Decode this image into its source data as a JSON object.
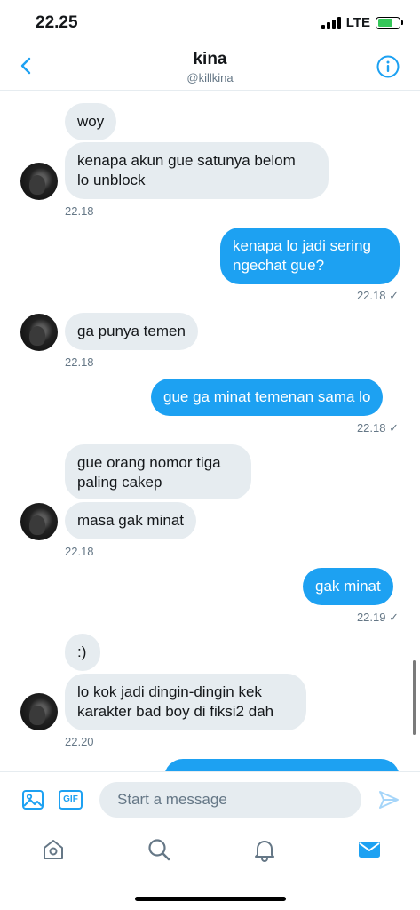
{
  "status": {
    "time": "22.25",
    "network": "LTE"
  },
  "header": {
    "name": "kina",
    "handle": "@killkina"
  },
  "messages": {
    "m1": "woy",
    "m2_l1": "kenapa akun gue satunya belom",
    "m2_l2": "lo unblock",
    "t1": "22.18",
    "m3_l1": "kenapa lo jadi sering",
    "m3_l2": "ngechat gue?",
    "t2": "22.18 ✓",
    "m4": "ga punya temen",
    "t3": "22.18",
    "m5": "gue ga minat temenan sama lo",
    "t4": "22.18 ✓",
    "m6_l1": "gue orang nomor tiga",
    "m6_l2": "paling cakep",
    "m7": "masa gak minat",
    "t5": "22.18",
    "m8": "gak minat",
    "t6": "22.19 ✓",
    "m9": ":)",
    "m10_l1": "lo kok jadi dingin-dingin kek",
    "m10_l2": "karakter bad boy di fiksi2 dah",
    "t7": "22.20"
  },
  "composer": {
    "gif_label": "GIF",
    "placeholder": "Start a message"
  },
  "colors": {
    "accent": "#1da1f2",
    "incoming": "#e6ecf0"
  },
  "icons": [
    "back-chevron-icon",
    "info-icon",
    "image-icon",
    "gif-icon",
    "send-icon",
    "home-icon",
    "search-icon",
    "bell-icon",
    "mail-icon"
  ]
}
